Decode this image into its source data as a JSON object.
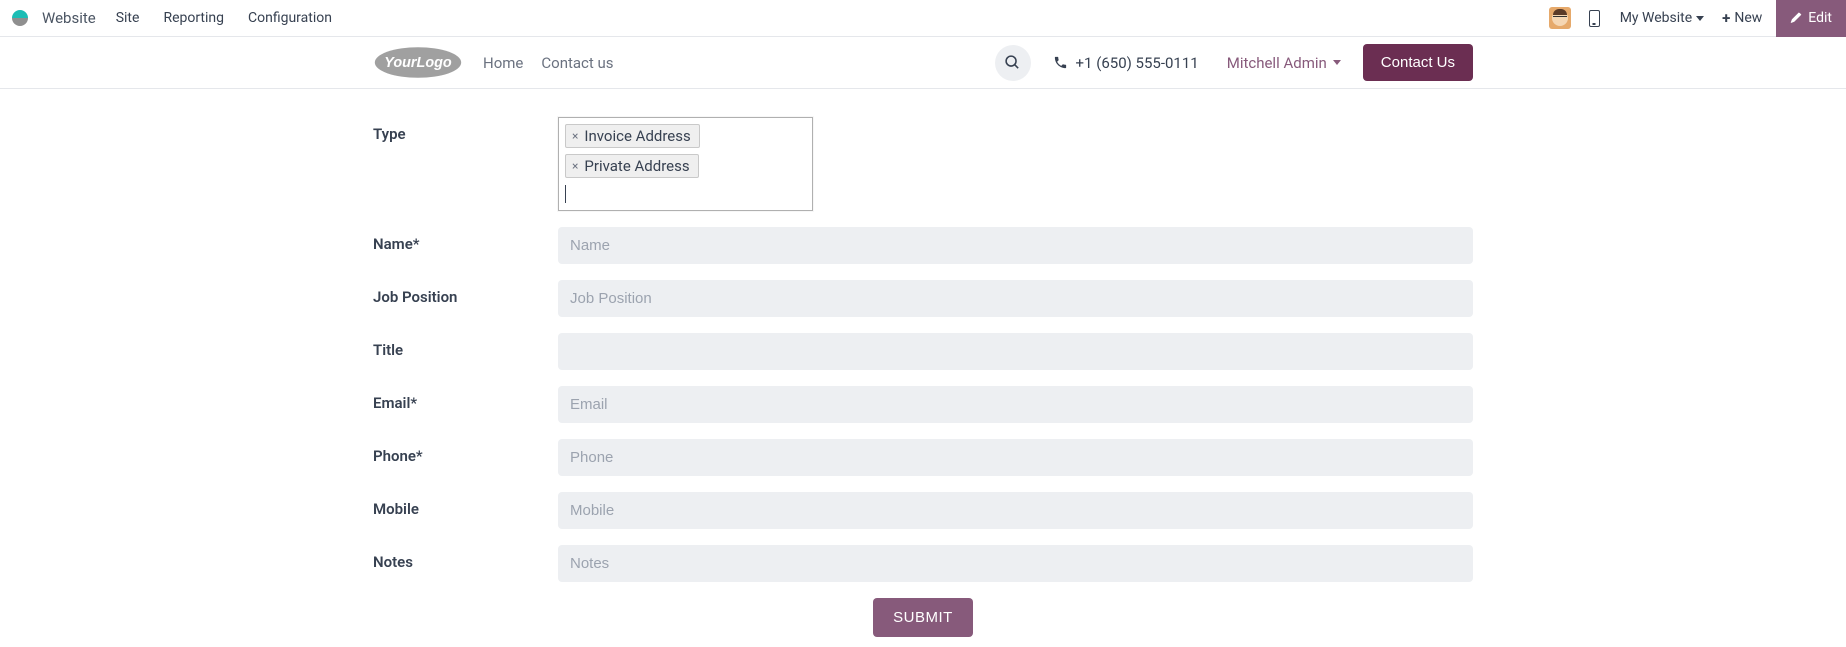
{
  "sysbar": {
    "app_name": "Website",
    "menu": [
      "Site",
      "Reporting",
      "Configuration"
    ],
    "my_website_label": "My Website",
    "new_label": "New",
    "edit_label": "Edit"
  },
  "sitenav": {
    "logo_text": "YourLogo",
    "links": [
      "Home",
      "Contact us"
    ],
    "phone": "+1 (650) 555-0111",
    "admin_name": "Mitchell Admin",
    "contact_us_label": "Contact Us"
  },
  "form": {
    "fields": {
      "type": {
        "label": "Type",
        "tags": [
          "Invoice Address",
          "Private Address"
        ]
      },
      "name": {
        "label": "Name*",
        "placeholder": "Name",
        "value": ""
      },
      "job": {
        "label": "Job Position",
        "placeholder": "Job Position",
        "value": ""
      },
      "title": {
        "label": "Title",
        "placeholder": "",
        "value": ""
      },
      "email": {
        "label": "Email*",
        "placeholder": "Email",
        "value": ""
      },
      "phone": {
        "label": "Phone*",
        "placeholder": "Phone",
        "value": ""
      },
      "mobile": {
        "label": "Mobile",
        "placeholder": "Mobile",
        "value": ""
      },
      "notes": {
        "label": "Notes",
        "placeholder": "Notes",
        "value": ""
      }
    },
    "submit_label": "SUBMIT"
  },
  "colors": {
    "accent": "#875a7b",
    "accent_dark": "#6b2e52",
    "muted_bg": "#edeff2"
  }
}
